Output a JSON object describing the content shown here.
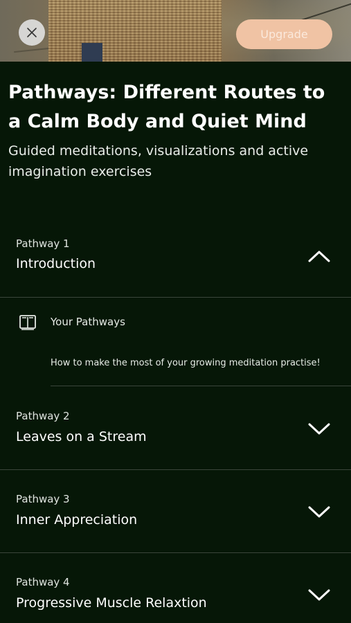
{
  "header": {
    "upgrade_label": "Upgrade",
    "title": "Pathways: Different Routes to a Calm Body and Quiet Mind",
    "subtitle": "Guided meditations, visualizations and active imagination exercises"
  },
  "pathways": [
    {
      "number_label": "Pathway 1",
      "name": "Introduction",
      "expanded": true
    },
    {
      "number_label": "Pathway 2",
      "name": "Leaves on a Stream",
      "expanded": false
    },
    {
      "number_label": "Pathway 3",
      "name": "Inner Appreciation",
      "expanded": false
    },
    {
      "number_label": "Pathway 4",
      "name": "Progressive Muscle Relaxtion",
      "expanded": false
    }
  ],
  "expanded_item": {
    "label": "Your Pathways",
    "description": "How to make the most of your growing meditation practise!"
  },
  "colors": {
    "background": "#061707",
    "upgrade_bg": "#f0c3a4",
    "divider": "#3b463b"
  },
  "icons": {
    "close": "close-icon",
    "book": "book-icon",
    "collapse": "chevron-up-icon",
    "expand": "chevron-down-icon"
  }
}
